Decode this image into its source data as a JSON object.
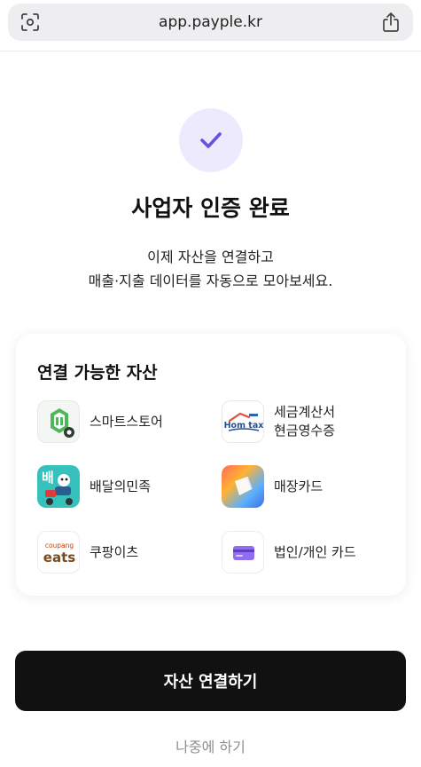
{
  "browser": {
    "url": "app.payple.kr",
    "left_icon": "scan-icon",
    "right_icon": "share-icon"
  },
  "success": {
    "icon": "check-icon",
    "title": "사업자 인증 완료",
    "description_line1": "이제 자산을 연결하고",
    "description_line2": "매출·지출 데이터를 자동으로 모아보세요."
  },
  "assets": {
    "title": "연결 가능한 자산",
    "items": [
      {
        "label": "스마트스토어",
        "icon": "smartstore-icon"
      },
      {
        "label_line1": "세금계산서",
        "label_line2": "현금영수증",
        "icon": "hometax-icon",
        "logo_text": "Hom tax"
      },
      {
        "label": "배달의민족",
        "icon": "baemin-icon",
        "logo_text": "배"
      },
      {
        "label": "매장카드",
        "icon": "store-card-icon"
      },
      {
        "label": "쿠팡이츠",
        "icon": "coupang-eats-icon",
        "logo_text_top": "coupang",
        "logo_text_main": "eats"
      },
      {
        "label": "법인/개인 카드",
        "icon": "credit-card-icon"
      }
    ]
  },
  "actions": {
    "primary_label": "자산 연결하기",
    "secondary_label": "나중에 하기"
  },
  "colors": {
    "accent_purple": "#6b52d9",
    "check_bg": "#eceafc",
    "primary_button": "#111111",
    "muted_text": "#8e8e93"
  }
}
